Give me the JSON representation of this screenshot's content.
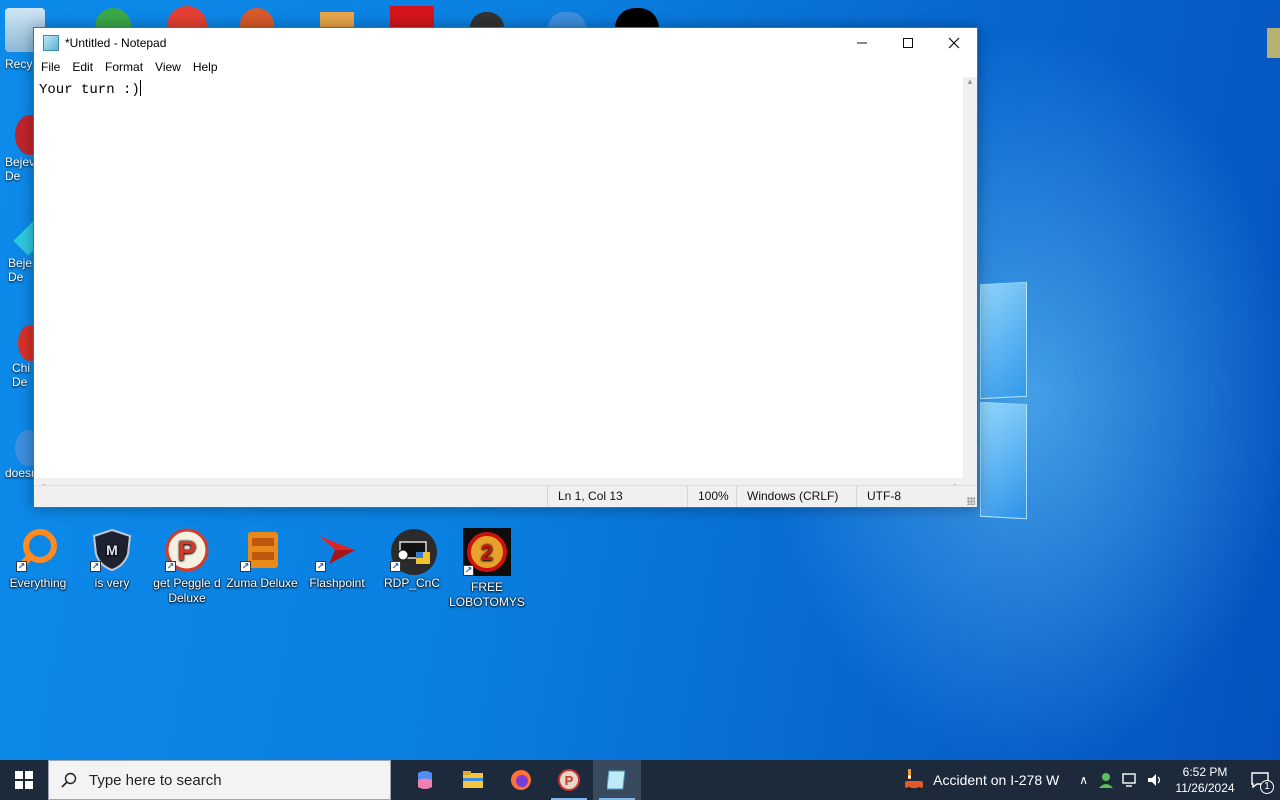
{
  "desktop": {
    "icons": [
      {
        "label": "Everything"
      },
      {
        "label": "is very"
      },
      {
        "label": "get Peggle d Deluxe"
      },
      {
        "label": "Zuma Deluxe"
      },
      {
        "label": "Flashpoint"
      },
      {
        "label": "RDP_CnC"
      },
      {
        "label": "FREE LOBOTOMYS"
      }
    ],
    "partial_labels": [
      "Recy",
      "Bejev De",
      "Beje De",
      "Chi De",
      "doesn"
    ]
  },
  "notepad": {
    "title": "*Untitled - Notepad",
    "menu": [
      "File",
      "Edit",
      "Format",
      "View",
      "Help"
    ],
    "content": "Your turn :)",
    "status": {
      "position": "Ln 1, Col 13",
      "zoom": "100%",
      "line_ending": "Windows (CRLF)",
      "encoding": "UTF-8"
    }
  },
  "taskbar": {
    "search_placeholder": "Type here to search",
    "news": "Accident on I-278 W",
    "time": "6:52 PM",
    "date": "11/26/2024",
    "notification_count": "1"
  }
}
